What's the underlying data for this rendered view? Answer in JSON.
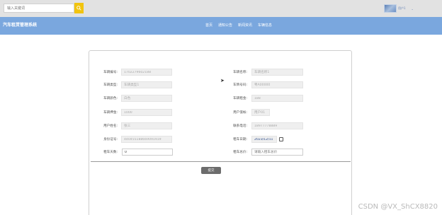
{
  "search": {
    "placeholder": "输入关键词"
  },
  "user": {
    "name": "用户1"
  },
  "nav": {
    "brand": "汽车租赁管理系统",
    "items": [
      "首页",
      "通知公告",
      "新闻资讯",
      "车辆信息"
    ]
  },
  "form": {
    "left": [
      {
        "label": "车辆编号:",
        "value": "1702279602188"
      },
      {
        "label": "车辆类型:",
        "value": "车辆类型1"
      },
      {
        "label": "车辆颜色:",
        "value": "白色"
      },
      {
        "label": "车辆押金:",
        "value": "1000"
      },
      {
        "label": "用户姓名:",
        "value": "张三"
      },
      {
        "label": "身份证号:",
        "value": "440455188669091919"
      },
      {
        "label": "租车天数:",
        "value": "0"
      }
    ],
    "right": [
      {
        "label": "车辆名称:",
        "value": "车辆名称1"
      },
      {
        "label": "车牌号码:",
        "value": "粤A00000"
      },
      {
        "label": "车辆租金:",
        "value": "188"
      },
      {
        "label": "用户值帐:",
        "value": "用户01"
      },
      {
        "label": "联系电话:",
        "value": "18977778889"
      },
      {
        "label": "租车日期:",
        "value": "2023/12/11"
      },
      {
        "label": "租车总价:",
        "placeholder": "请输入租车总价"
      }
    ],
    "submit_label": "提交"
  },
  "watermark": "CSDN @VX_ShCX8820"
}
